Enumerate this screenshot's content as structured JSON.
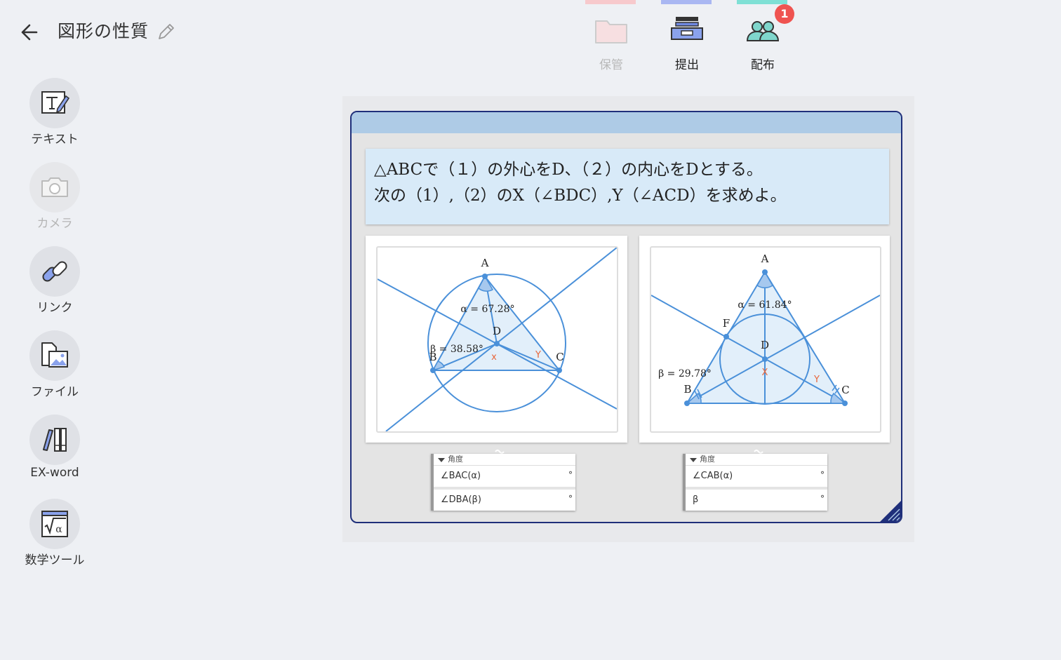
{
  "header": {
    "title": "図形の性質"
  },
  "top_toolbar": {
    "items": [
      {
        "label": "保管",
        "disabled": true,
        "bar_color": "#f7c9cc"
      },
      {
        "label": "提出",
        "disabled": false,
        "bar_color": "#a9b7f2"
      },
      {
        "label": "配布",
        "disabled": false,
        "bar_color": "#7fe0d5",
        "badge": "1"
      }
    ]
  },
  "sidebar": {
    "items": [
      {
        "label": "テキスト",
        "icon": "text-edit-icon"
      },
      {
        "label": "カメラ",
        "icon": "camera-icon",
        "disabled": true
      },
      {
        "label": "リンク",
        "icon": "link-icon"
      },
      {
        "label": "ファイル",
        "icon": "file-image-icon"
      },
      {
        "label": "EX-word",
        "icon": "books-icon"
      },
      {
        "label": "数学ツール",
        "icon": "sqrt-alpha-icon"
      }
    ]
  },
  "question": {
    "line1": "△ABCで（１）の外心をD、（２）の内心をDとする。",
    "line2": "次の（1）,（2）のX（∠BDC）,Y（∠ACD）を求めよ。"
  },
  "figure1": {
    "labels": {
      "A": "A",
      "B": "B",
      "C": "C",
      "D": "D",
      "x": "x",
      "y": "Y"
    },
    "alpha": "α = 67.28°",
    "beta": "β = 38.58°"
  },
  "figure2": {
    "labels": {
      "A": "A",
      "B": "B",
      "C": "C",
      "D": "D",
      "F": "F",
      "x": "X",
      "y": "Y"
    },
    "alpha": "α = 61.84°",
    "beta": "β = 29.78°"
  },
  "table1": {
    "header": "角度",
    "rows": [
      {
        "label": "∠BAC(α)",
        "unit": "°"
      },
      {
        "label": "∠DBA(β)",
        "unit": "°"
      }
    ]
  },
  "table2": {
    "header": "角度",
    "rows": [
      {
        "label": "∠CAB(α)",
        "unit": "°"
      },
      {
        "label": "β",
        "unit": "°"
      }
    ]
  },
  "colors": {
    "accent": "#1f2f7a",
    "geometry": "#4a90d9",
    "angle_label": "#e8663a"
  }
}
